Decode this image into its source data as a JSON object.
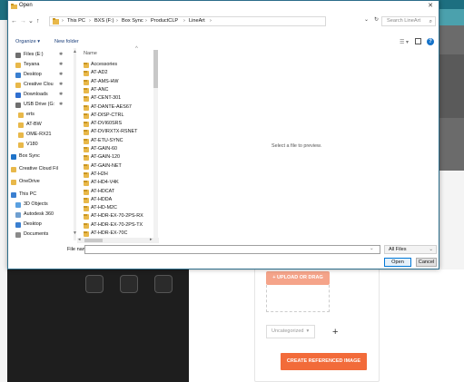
{
  "dialog": {
    "title": "Open",
    "close_glyph": "✕",
    "address": {
      "back_glyph": "←",
      "forward_glyph": "→",
      "up_history_glyph": "⌄",
      "up_glyph": "↑",
      "crumbs": [
        "This PC",
        "BXS (F:)",
        "Box Sync",
        "ProductCLP",
        "LineArt"
      ],
      "separator": "›",
      "dropdown_glyph": "⌄",
      "refresh_glyph": "↻"
    },
    "search": {
      "placeholder": "Search LineArt",
      "icon_glyph": "⌕"
    },
    "toolbar": {
      "organize": "Organize ▾",
      "new_folder": "New folder",
      "view_glyph": "☰ ▾",
      "help_glyph": "?"
    },
    "nav": [
      {
        "label": "Files (E:)",
        "pin": "✱",
        "color": "#6f6f6f"
      },
      {
        "label": "Teyana",
        "pin": "✱",
        "color": "#e8b84a"
      },
      {
        "label": "Desktop",
        "pin": "✱",
        "color": "#3a7fd0"
      },
      {
        "label": "Creative Clou",
        "pin": "✱",
        "color": "#e8b84a"
      },
      {
        "label": "Downloads",
        "pin": "✱",
        "color": "#2f6fd0"
      },
      {
        "label": "USB Drive (G:",
        "pin": "✱",
        "color": "#6f6f6f"
      },
      {
        "label": "erts",
        "pin": "",
        "color": "#e8b84a"
      },
      {
        "label": "AT-BW",
        "pin": "",
        "color": "#e8b84a"
      },
      {
        "label": "OME-RX21",
        "pin": "",
        "color": "#e8b84a"
      },
      {
        "label": "V180",
        "pin": "",
        "color": "#e8b84a"
      },
      {
        "label": "Box Sync",
        "pin": "",
        "color": "#1f73c9"
      },
      {
        "label": "Creative Cloud Fil",
        "pin": "",
        "color": "#e8b84a"
      },
      {
        "label": "OneDrive",
        "pin": "",
        "color": "#e8b84a"
      },
      {
        "label": "This PC",
        "pin": "",
        "color": "#3a7fd0"
      },
      {
        "label": "3D Objects",
        "pin": "",
        "color": "#5aa0e0"
      },
      {
        "label": "Autodesk 360",
        "pin": "",
        "color": "#6f9fd0"
      },
      {
        "label": "Desktop",
        "pin": "",
        "color": "#3a7fd0"
      },
      {
        "label": "Documents",
        "pin": "",
        "color": "#8a8a8a"
      },
      {
        "label": "Downloads",
        "pin": "",
        "color": "#2f6fd0"
      }
    ],
    "list_header": {
      "name": "Name",
      "sort_glyph": "^"
    },
    "files": [
      "Accessories",
      "AT-AD2",
      "AT-AMS-HW",
      "AT-ANC",
      "AT-CENT-301",
      "AT-DANTE-AES67",
      "AT-DISP-CTRL",
      "AT-DVI60SRS",
      "AT-DVIRXTX-RSNET",
      "AT-ETU-SYNC",
      "AT-GAIN-60",
      "AT-GAIN-120",
      "AT-GAIN-NET",
      "AT-H2H",
      "AT-HD4-V4K",
      "AT-HDCAT",
      "AT-HDDA",
      "AT-HD-M2C",
      "AT-HDR-EX-70-2PS-RX",
      "AT-HDR-EX-70-2PS-TX",
      "AT-HDR-EX-70C"
    ],
    "preview_message": "Select a file to preview.",
    "file_name": {
      "label": "File name:",
      "value": "",
      "dropdown_glyph": "⌄"
    },
    "filter": {
      "value": "All Files",
      "dropdown_glyph": "⌄"
    },
    "buttons": {
      "open": "Open",
      "cancel": "Cancel"
    }
  },
  "background": {
    "upload_button": "+ UPLOAD OR DRAG",
    "category_select": "Uncategorized",
    "category_caret": "▾",
    "add_category": "+",
    "create_button": "CREATE REFERENCED IMAGE"
  }
}
